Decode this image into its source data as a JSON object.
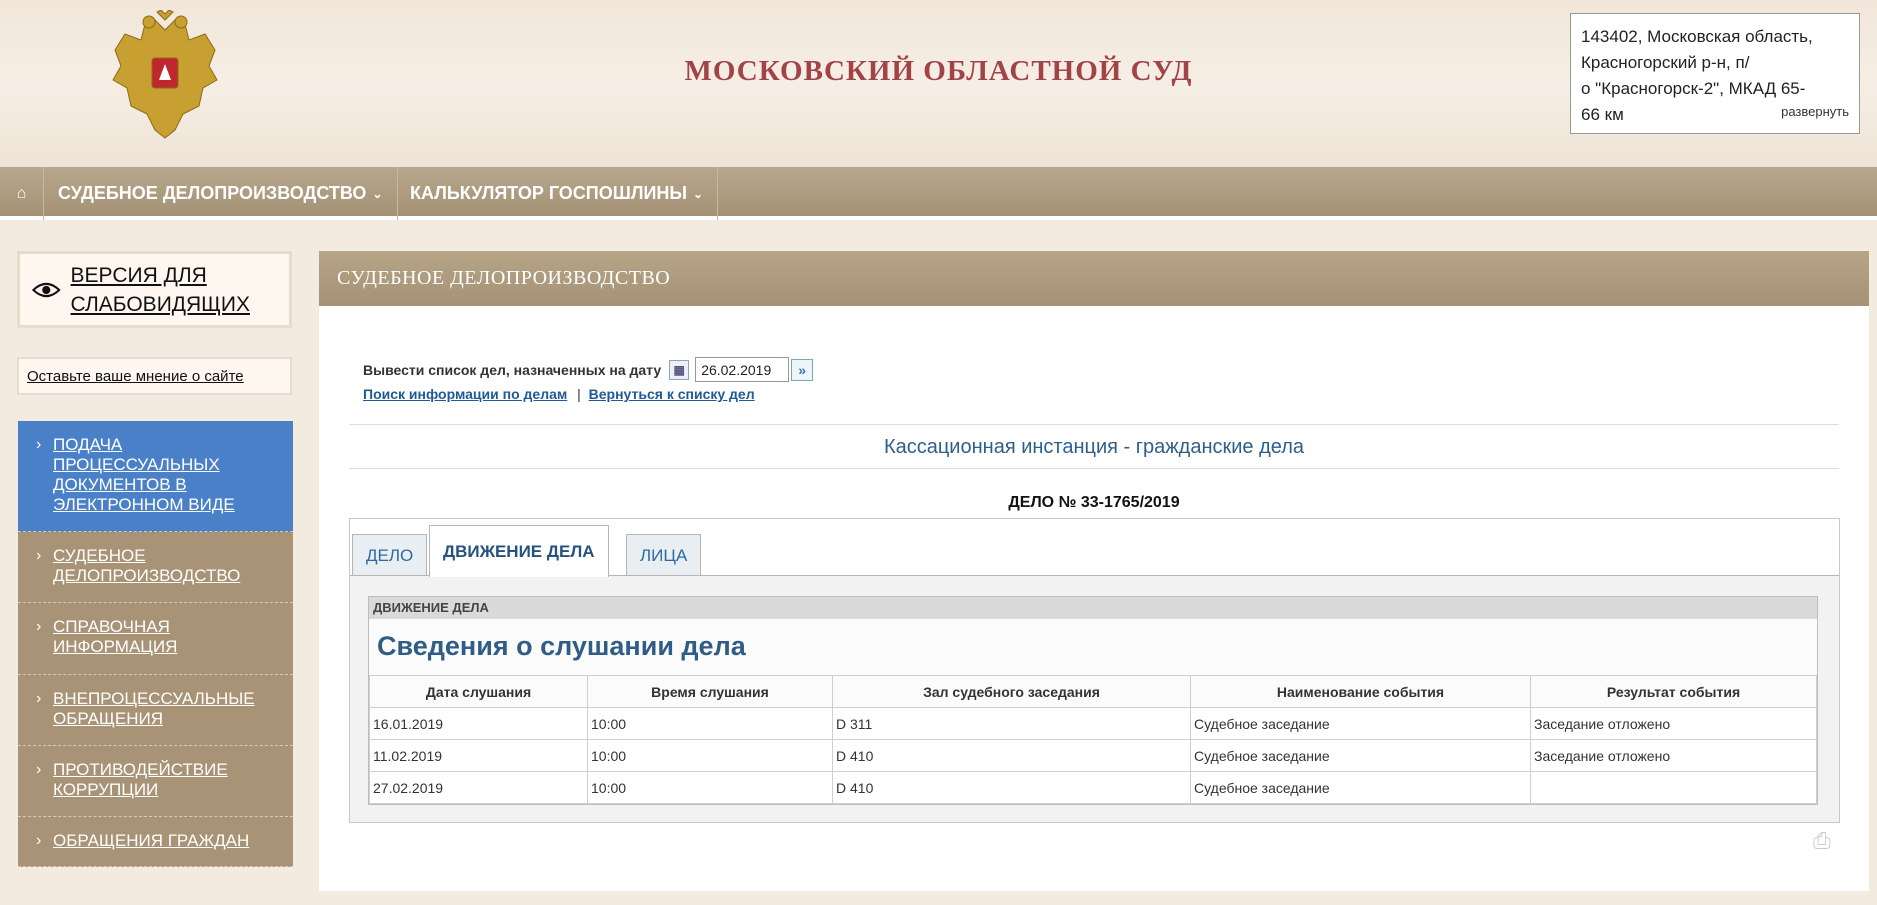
{
  "header": {
    "title": "МОСКОВСКИЙ ОБЛАСТНОЙ СУД",
    "address_lines": [
      "143402, Московская область,",
      "Красногорский р-н, п/",
      "о \"Красногорск-2\", МКАД 65-",
      "66 км"
    ],
    "address_expand": "развернуть"
  },
  "nav": {
    "home_icon": "home-icon",
    "items": [
      {
        "label": "СУДЕБНОЕ ДЕЛОПРОИЗВОДСТВО"
      },
      {
        "label": "КАЛЬКУЛЯТОР ГОСПОШЛИНЫ"
      }
    ]
  },
  "sidebar": {
    "vision_label": "ВЕРСИЯ ДЛЯ СЛАБОВИДЯЩИХ",
    "feedback_label": "Оставьте ваше мнение о сайте",
    "menu": [
      {
        "label": "ПОДАЧА ПРОЦЕССУАЛЬНЫХ ДОКУМЕНТОВ В ЭЛЕКТРОННОМ ВИДЕ",
        "active": true
      },
      {
        "label": "СУДЕБНОЕ ДЕЛОПРОИЗВОДСТВО"
      },
      {
        "label": "СПРАВОЧНАЯ ИНФОРМАЦИЯ"
      },
      {
        "label": "ВНЕПРОЦЕССУАЛЬНЫЕ ОБРАЩЕНИЯ"
      },
      {
        "label": "ПРОТИВОДЕЙСТВИЕ КОРРУПЦИИ"
      },
      {
        "label": "ОБРАЩЕНИЯ ГРАЖДАН"
      }
    ]
  },
  "main": {
    "section_title": "СУДЕБНОЕ ДЕЛОПРОИЗВОДСТВО",
    "date_prompt": "Вывести список дел, назначенных на дату",
    "date_value": "26.02.2019",
    "search_link": "Поиск информации по делам",
    "link_separator": "|",
    "back_link": "Вернуться к списку дел",
    "instance_title": "Кассационная инстанция - гражданские дела",
    "case_number": "ДЕЛО № 33-1765/2019",
    "tabs": [
      {
        "label": "ДЕЛО"
      },
      {
        "label": "ДВИЖЕНИЕ ДЕЛА",
        "active": true
      },
      {
        "label": "ЛИЦА"
      }
    ],
    "movement": {
      "label": "ДВИЖЕНИЕ ДЕЛА",
      "title": "Сведения о слушании дела",
      "columns": [
        "Дата слушания",
        "Время слушания",
        "Зал судебного заседания",
        "Наименование события",
        "Результат события"
      ],
      "rows": [
        [
          "16.01.2019",
          "10:00",
          "D 311",
          "Судебное заседание",
          "Заседание отложено"
        ],
        [
          "11.02.2019",
          "10:00",
          "D 410",
          "Судебное заседание",
          "Заседание отложено"
        ],
        [
          "27.02.2019",
          "10:00",
          "D 410",
          "Судебное заседание",
          ""
        ]
      ]
    },
    "print_icon": "printer-icon"
  },
  "colors": {
    "title_red": "#a04448",
    "nav_bg": "#a89377",
    "active_blue": "#4a80c8",
    "link_blue": "#1f5a96",
    "heading_blue": "#2f5d86"
  }
}
